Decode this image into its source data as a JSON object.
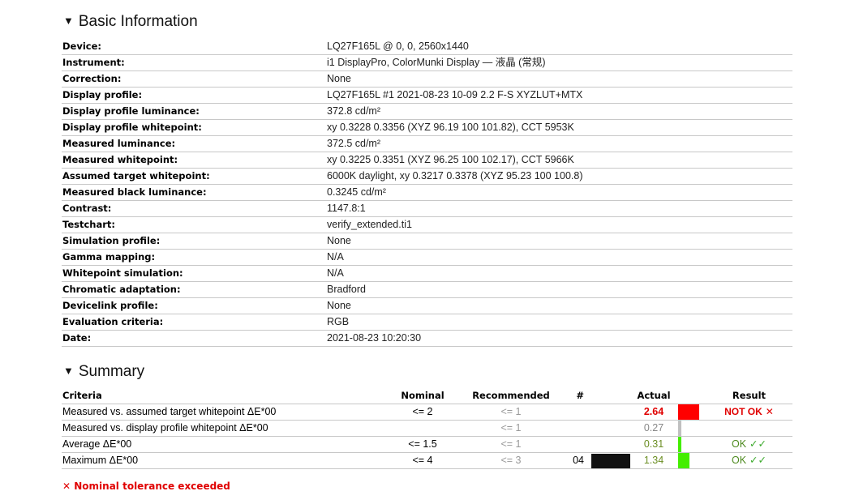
{
  "basic": {
    "title": "Basic Information",
    "rows": [
      {
        "label": "Device:",
        "value": "LQ27F165L @ 0, 0, 2560x1440"
      },
      {
        "label": "Instrument:",
        "value": "i1 DisplayPro, ColorMunki Display — 液晶 (常规)"
      },
      {
        "label": "Correction:",
        "value": "None"
      },
      {
        "label": "Display profile:",
        "value": "LQ27F165L #1 2021-08-23 10-09 2.2 F-S XYZLUT+MTX"
      },
      {
        "label": "Display profile luminance:",
        "value": "372.8 cd/m²"
      },
      {
        "label": "Display profile whitepoint:",
        "value": "xy 0.3228 0.3356 (XYZ 96.19 100 101.82), CCT 5953K"
      },
      {
        "label": "Measured luminance:",
        "value": "372.5 cd/m²"
      },
      {
        "label": "Measured whitepoint:",
        "value": "xy 0.3225 0.3351 (XYZ 96.25 100 102.17), CCT 5966K"
      },
      {
        "label": "Assumed target whitepoint:",
        "value": "6000K daylight, xy 0.3217 0.3378 (XYZ 95.23 100 100.8)"
      },
      {
        "label": "Measured black luminance:",
        "value": "0.3245 cd/m²"
      },
      {
        "label": "Contrast:",
        "value": "1147.8:1"
      },
      {
        "label": "Testchart:",
        "value": "verify_extended.ti1"
      },
      {
        "label": "Simulation profile:",
        "value": "None"
      },
      {
        "label": "Gamma mapping:",
        "value": "N/A"
      },
      {
        "label": "Whitepoint simulation:",
        "value": "N/A"
      },
      {
        "label": "Chromatic adaptation:",
        "value": "Bradford"
      },
      {
        "label": "Devicelink profile:",
        "value": "None"
      },
      {
        "label": "Evaluation criteria:",
        "value": "RGB"
      },
      {
        "label": "Date:",
        "value": "2021-08-23 10:20:30"
      }
    ]
  },
  "summary": {
    "title": "Summary",
    "headers": {
      "criteria": "Criteria",
      "nominal": "Nominal",
      "recommended": "Recommended",
      "num": "#",
      "actual": "Actual",
      "result": "Result"
    },
    "rows": [
      {
        "criteria": "Measured vs. assumed target whitepoint ΔE*00",
        "nominal": "<= 2",
        "recommended": "<= 1",
        "num": "",
        "swatch": "",
        "actual": "2.64",
        "actual_status": "bad",
        "bar_fraction": 0.66,
        "bar_color": "#ff0000",
        "result": "NOT OK",
        "result_icon": "✕",
        "result_status": "bad"
      },
      {
        "criteria": "Measured vs. display profile whitepoint ΔE*00",
        "nominal": "",
        "recommended": "<= 1",
        "num": "",
        "swatch": "",
        "actual": "0.27",
        "actual_status": "neutral",
        "bar_fraction": 0.07,
        "bar_color": "#c0c0c0",
        "result": "",
        "result_icon": "",
        "result_status": "none"
      },
      {
        "criteria": "Average ΔE*00",
        "nominal": "<= 1.5",
        "recommended": "<= 1",
        "num": "",
        "swatch": "",
        "actual": "0.31",
        "actual_status": "good",
        "bar_fraction": 0.08,
        "bar_color": "#44ee00",
        "result": "OK",
        "result_icon": "✓✓",
        "result_status": "good"
      },
      {
        "criteria": "Maximum ΔE*00",
        "nominal": "<= 4",
        "recommended": "<= 3",
        "num": "04",
        "swatch": "#111111",
        "actual": "1.34",
        "actual_status": "good",
        "bar_fraction": 0.34,
        "bar_color": "#44ee00",
        "result": "OK",
        "result_icon": "✓✓",
        "result_status": "good"
      }
    ],
    "footer": {
      "icon": "✕",
      "text": "Nominal tolerance exceeded"
    }
  }
}
